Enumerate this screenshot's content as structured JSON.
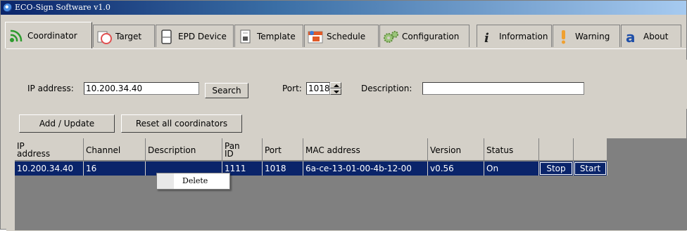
{
  "window": {
    "title": "ECO-Sign Software v1.0"
  },
  "tabs": [
    {
      "label": "Coordinator",
      "icon": "wifi-signal-icon",
      "active": true
    },
    {
      "label": "Target",
      "icon": "target-circle-icon",
      "active": false
    },
    {
      "label": "EPD Device",
      "icon": "epd-device-icon",
      "active": false
    },
    {
      "label": "Template",
      "icon": "template-doc-icon",
      "active": false
    },
    {
      "label": "Schedule",
      "icon": "calendar-icon",
      "active": false
    },
    {
      "label": "Configuration",
      "icon": "gears-icon",
      "active": false
    },
    {
      "label": "Information",
      "icon": "info-icon",
      "active": false
    },
    {
      "label": "Warning",
      "icon": "warning-icon",
      "active": false
    },
    {
      "label": "About",
      "icon": "about-icon",
      "active": false
    }
  ],
  "form": {
    "ip_label": "IP address:",
    "ip_value": "10.200.34.40",
    "search_label": "Search",
    "port_label": "Port:",
    "port_value": "1018",
    "description_label": "Description:",
    "description_value": ""
  },
  "actions": {
    "add_update": "Add / Update",
    "reset_all": "Reset all coordinators"
  },
  "table": {
    "headers": [
      "IP\naddress",
      "Channel",
      "Description",
      "Pan\nID",
      "Port",
      "MAC address",
      "Version",
      "Status",
      "",
      ""
    ],
    "rows": [
      {
        "ip": "10.200.34.40",
        "channel": "16",
        "description": "",
        "pan_id": "1111",
        "port": "1018",
        "mac": "6a-ce-13-01-00-4b-12-00",
        "version": "v0.56",
        "status": "On",
        "stop_label": "Stop",
        "start_label": "Start"
      }
    ]
  },
  "context_menu": {
    "items": [
      "Delete"
    ]
  },
  "colors": {
    "selection": "#0a246a",
    "face": "#d4d0c8",
    "grid_bg": "#808080",
    "title_start": "#0a246a",
    "title_end": "#a6caf0"
  }
}
